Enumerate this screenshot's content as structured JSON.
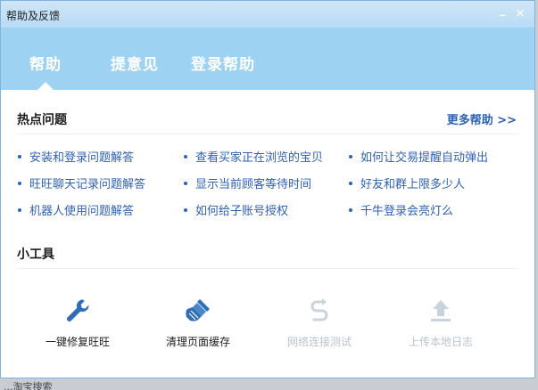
{
  "window": {
    "title": "帮助及反馈",
    "minimize_glyph": "_",
    "close_glyph": "×"
  },
  "tabs": [
    {
      "label": "帮助",
      "active": true
    },
    {
      "label": "提意见",
      "active": false
    },
    {
      "label": "登录帮助",
      "active": false
    }
  ],
  "hot": {
    "title": "热点问题",
    "more_label": "更多帮助 >>",
    "columns": [
      [
        "安装和登录问题解答",
        "旺旺聊天记录问题解答",
        "机器人使用问题解答"
      ],
      [
        "查看买家正在浏览的宝贝",
        "显示当前顾客等待时间",
        "如何给子账号授权"
      ],
      [
        "如何让交易提醒自动弹出",
        "好友和群上限多少人",
        "千牛登录会亮灯么"
      ]
    ]
  },
  "tools": {
    "title": "小工具",
    "items": [
      {
        "label": "一键修复旺旺",
        "icon": "wrench-icon",
        "enabled": true
      },
      {
        "label": "清理页面缓存",
        "icon": "brush-icon",
        "enabled": true
      },
      {
        "label": "网络连接测试",
        "icon": "network-test-icon",
        "enabled": false
      },
      {
        "label": "上传本地日志",
        "icon": "upload-icon",
        "enabled": false
      }
    ]
  },
  "colors": {
    "tab_bar": "#9dd2f3",
    "link": "#2f61b5",
    "icon_blue": "#2f6db8",
    "disabled": "#c9d3dc"
  },
  "background_text": "...淘宝搜索"
}
